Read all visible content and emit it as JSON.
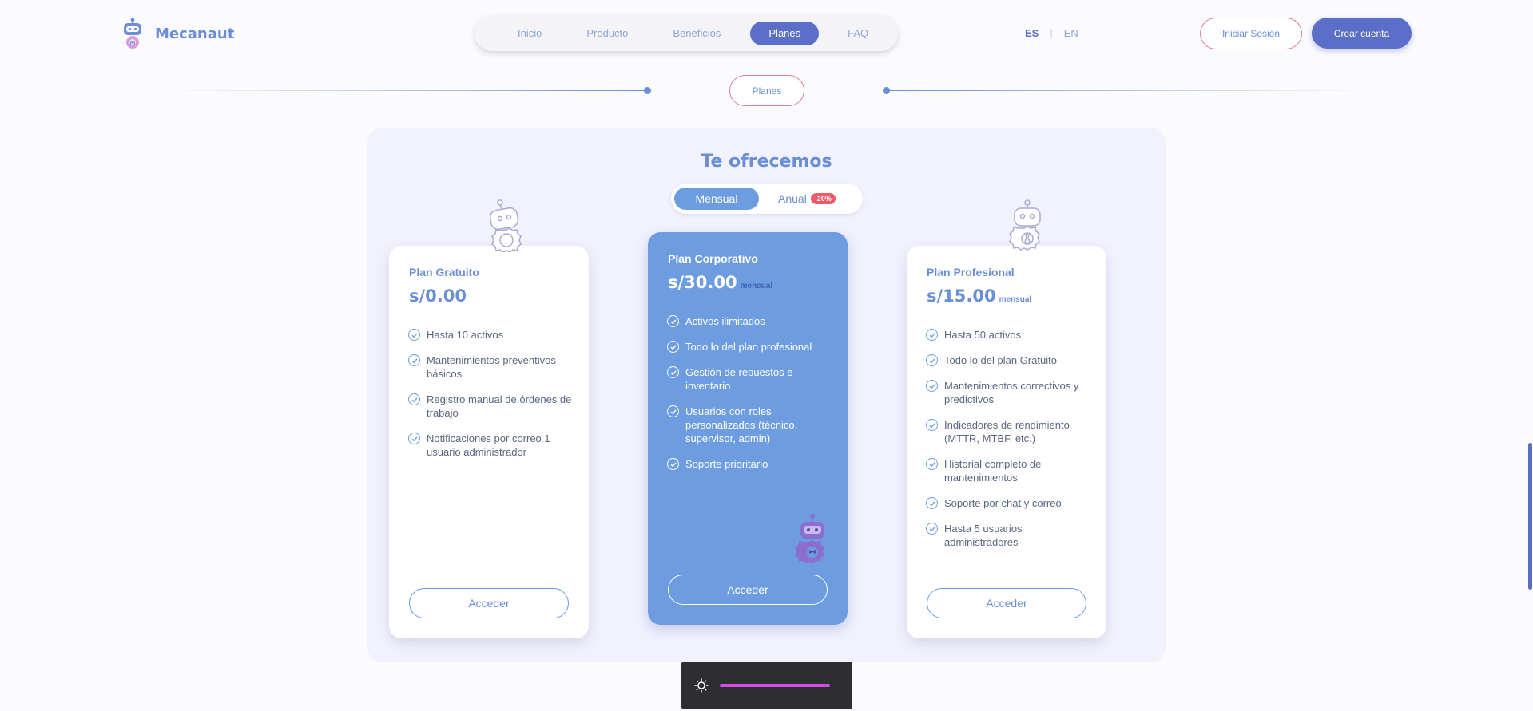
{
  "header": {
    "brand": "Mecanaut",
    "nav": [
      "Inicio",
      "Producto",
      "Beneficios",
      "Planes",
      "FAQ"
    ],
    "active_nav": "Planes",
    "lang_es": "ES",
    "lang_sep": "|",
    "lang_en": "EN",
    "login": "Iniciar Sesión",
    "signup": "Crear cuenta"
  },
  "section": {
    "pill": "Planes"
  },
  "plans": {
    "title": "Te ofrecemos",
    "toggle_monthly": "Mensual",
    "toggle_annual": "Anual",
    "discount": "-20%",
    "cards": [
      {
        "name": "Plan Gratuito",
        "price": "s/0.00",
        "period": "",
        "features": [
          "Hasta 10 activos",
          "Mantenimientos preventivos básicos",
          "Registro manual de órdenes de trabajo",
          "Notificaciones por correo 1 usuario administrador"
        ],
        "cta": "Acceder"
      },
      {
        "name": "Plan Corporativo",
        "price": "s/30.00",
        "period": "mensual",
        "features": [
          "Activos ilimitados",
          "Todo lo del plan profesional",
          "Gestión de repuestos e inventario",
          "Usuarios con roles personalizados (técnico, supervisor, admin)",
          "Soporte prioritario"
        ],
        "cta": "Acceder"
      },
      {
        "name": "Plan Profesional",
        "price": "s/15.00",
        "period": "mensual",
        "features": [
          "Hasta 50 activos",
          "Todo lo del plan Gratuito",
          "Mantenimientos correctivos y predictivos",
          "Indicadores de rendimiento (MTTR, MTBF, etc.)",
          "Historial completo de mantenimientos",
          "Soporte por chat y correo",
          "Hasta 5 usuarios administradores"
        ],
        "cta": "Acceder"
      }
    ]
  },
  "colors": {
    "accent": "#6b8fd6",
    "primary": "#5b6ec8",
    "card_highlight": "#6d9de0",
    "pink": "#e07a9d",
    "slider": "#d24ee3"
  },
  "brightness": {
    "icon": "sun-icon"
  }
}
